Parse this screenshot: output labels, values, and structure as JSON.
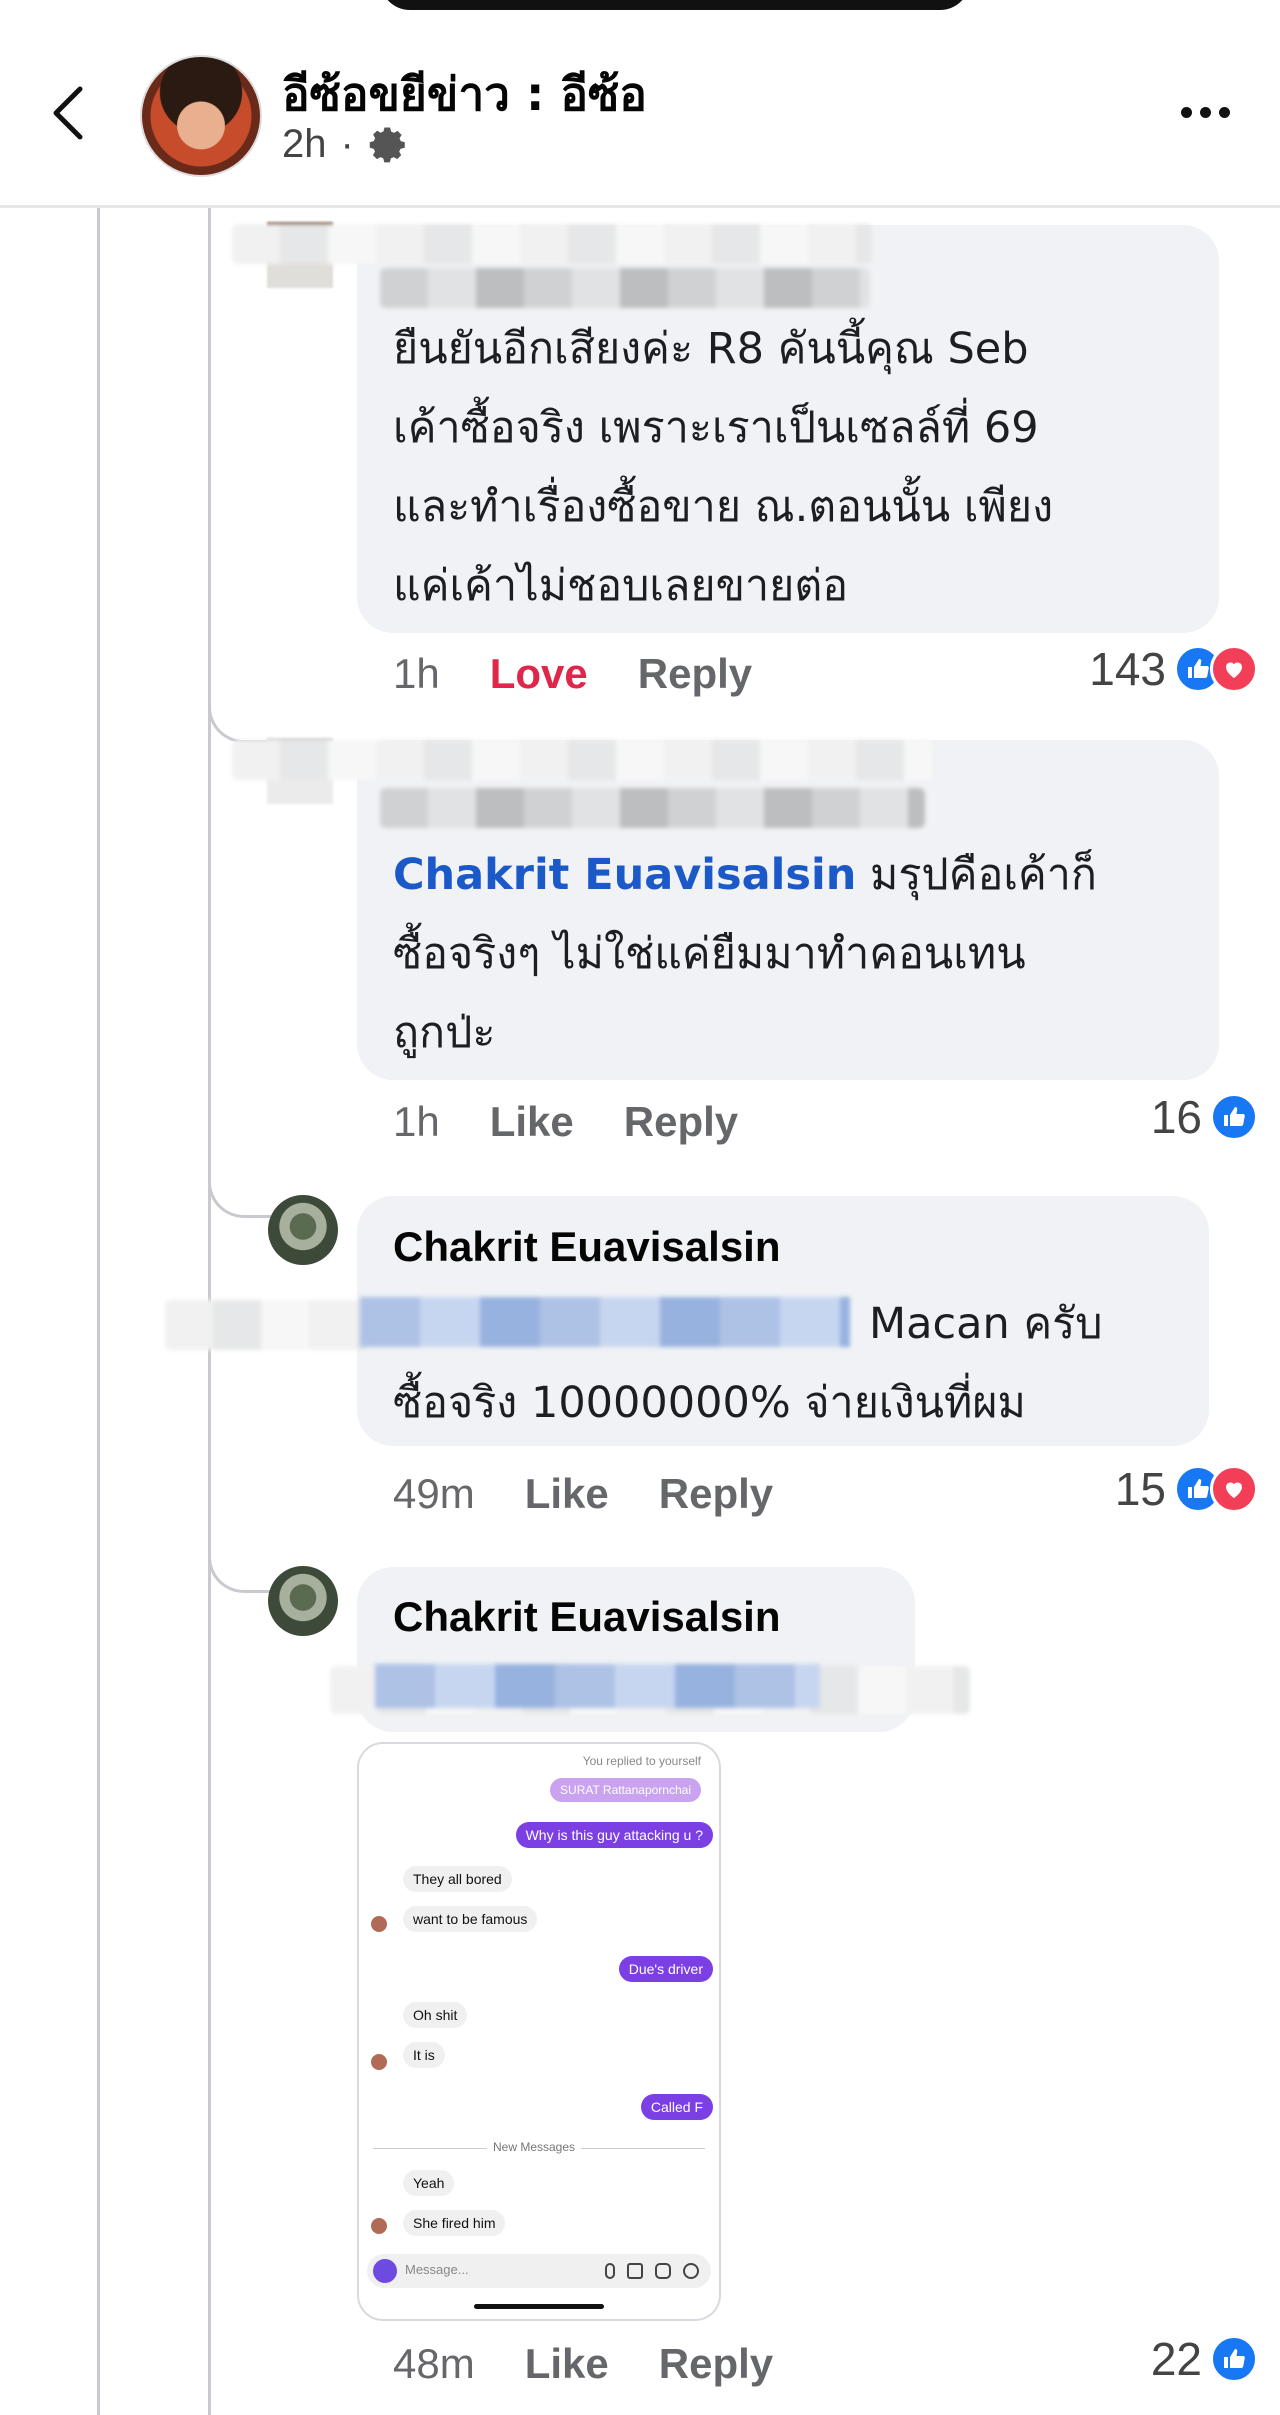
{
  "header": {
    "title": "อีซ้อขยีข่าว : อีซ้อ",
    "time": "2h",
    "separator": "·"
  },
  "comments": [
    {
      "text_lines": [
        "ยืนยันอีกเสียงค่ะ R8 คันนี้คุณ Seb",
        "เค้าซื้อจริง เพราะเราเป็นเซลล์ที่ 69",
        "และทำเรื่องซื้อขาย ณ.ตอนนั้น เพียง",
        "แค่เค้าไม่ชอบเลยขายต่อ"
      ],
      "time": "1h",
      "reaction_label": "Love",
      "reply_label": "Reply",
      "reaction_count": "143"
    },
    {
      "mention": "Chakrit Euavisalsin",
      "text_lines": [
        " มรุปคือเค้าก็",
        "ซื้อจริงๆ ไม่ใช่แค่ยืมมาทำคอนเทน",
        "ถูกป่ะ"
      ],
      "time": "1h",
      "reaction_label": "Like",
      "reply_label": "Reply",
      "reaction_count": "16"
    },
    {
      "author": "Chakrit Euavisalsin",
      "text_lines": [
        "Macan ครับ",
        "ซื้อจริง 10000000% จ่ายเงินที่ผม"
      ],
      "time": "49m",
      "reaction_label": "Like",
      "reply_label": "Reply",
      "reaction_count": "15"
    },
    {
      "author": "Chakrit Euavisalsin",
      "time": "48m",
      "reaction_label": "Like",
      "reply_label": "Reply",
      "reaction_count": "22",
      "attachment": {
        "replied_note": "You replied to yourself",
        "quoted": "SURAT Rattanapornchai",
        "messages": [
          "Why is this guy attacking u ?",
          "They all bored",
          "want to be famous",
          "Due's driver",
          "Oh shit",
          "It is",
          "Called F",
          "New Messages",
          "Yeah",
          "She fired him"
        ],
        "input_placeholder": "Message..."
      }
    }
  ],
  "colors": {
    "link": "#1b59c9",
    "love": "#e0274b",
    "like_icon": "#1877f2",
    "love_icon": "#f33e58",
    "bubble": "#f0f2f5",
    "chat_sent": "#7b3fe4"
  }
}
